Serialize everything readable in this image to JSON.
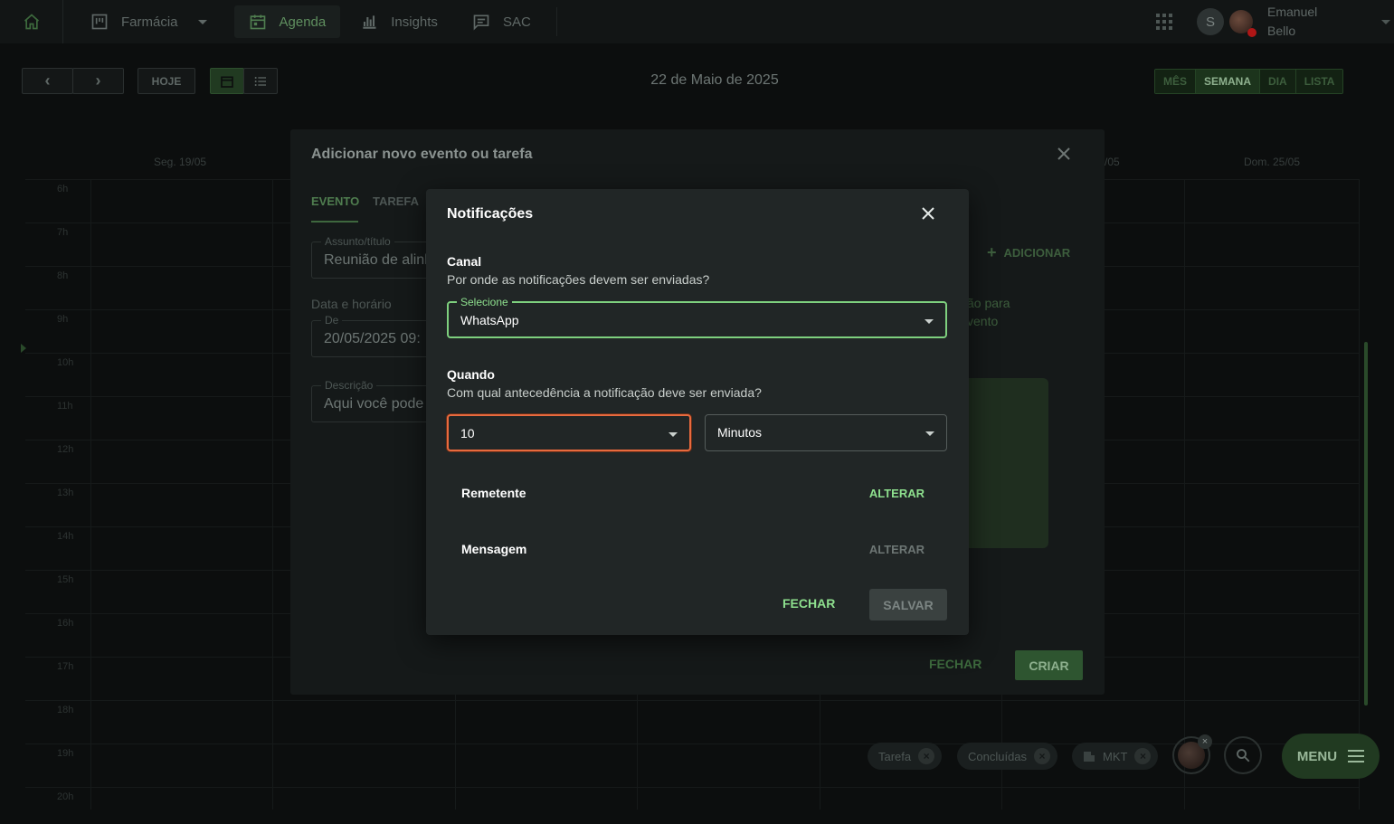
{
  "nav": {
    "items": [
      {
        "label": "Farmácia",
        "icon": "kanban-icon"
      },
      {
        "label": "Agenda",
        "icon": "calendar-icon"
      },
      {
        "label": "Insights",
        "icon": "bar-chart-icon"
      },
      {
        "label": "SAC",
        "icon": "chat-icon"
      }
    ],
    "user": {
      "initial": "S",
      "first_name": "Emanuel",
      "last_name": "Bello"
    }
  },
  "toolbar": {
    "prev": "‹",
    "next": "›",
    "today_label": "HOJE",
    "date_title": "22 de Maio de 2025",
    "views": [
      "MÊS",
      "SEMANA",
      "DIA",
      "LISTA"
    ],
    "selected_view": "SEMANA"
  },
  "calendar": {
    "day_headers": {
      "mon": "Seg. 19/05",
      "fri_partial": "/05",
      "sun": "Dom. 25/05"
    },
    "hours": [
      "6h",
      "7h",
      "8h",
      "9h",
      "10h",
      "11h",
      "12h",
      "13h",
      "14h",
      "15h",
      "16h",
      "17h",
      "18h",
      "19h",
      "20h"
    ]
  },
  "event_modal": {
    "title": "Adicionar novo evento ou tarefa",
    "tabs": [
      "EVENTO",
      "TAREFA"
    ],
    "subject_label": "Assunto/título",
    "subject_value": "Reunião de alinh",
    "datetime_section": "Data e horário",
    "from_label": "De",
    "from_value": "20/05/2025 09:",
    "description_label": "Descrição",
    "description_value": "Aqui você pode",
    "add_label": "ADICIONAR",
    "side_text_1": "ão para",
    "side_text_2": "vento",
    "close_label": "FECHAR",
    "create_label": "CRIAR"
  },
  "notifications_modal": {
    "title": "Notificações",
    "channel_title": "Canal",
    "channel_subtitle": "Por onde as notificações devem ser enviadas?",
    "channel_select_label": "Selecione",
    "channel_value": "WhatsApp",
    "when_title": "Quando",
    "when_subtitle": "Com qual antecedência a notificação deve ser enviada?",
    "amount_value": "10",
    "unit_value": "Minutos",
    "sender_label": "Remetente",
    "sender_action": "ALTERAR",
    "message_label": "Mensagem",
    "message_action": "ALTERAR",
    "close_label": "FECHAR",
    "save_label": "SALVAR"
  },
  "filters": {
    "chips": [
      "Tarefa",
      "Concluídas",
      "MKT"
    ],
    "menu_label": "MENU"
  },
  "colors": {
    "accent_green": "#8ee08e",
    "focus_orange": "#e86a3e",
    "dialog_bg": "#212626"
  }
}
